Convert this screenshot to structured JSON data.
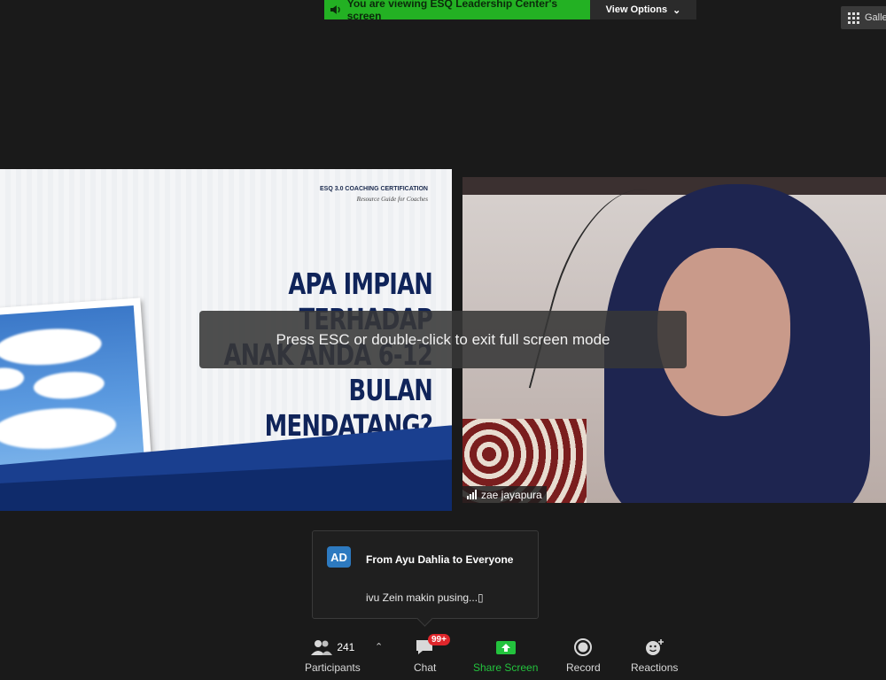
{
  "banner": {
    "text": "You are viewing ESQ Leadership Center's screen"
  },
  "view_options": {
    "label": "View Options"
  },
  "gallery": {
    "label": "Galle"
  },
  "slide": {
    "header_line1": "ESQ 3.0 COACHING CERTIFICATION",
    "header_line2": "Resource Guide for Coaches",
    "title_line1": "APA IMPIAN TERHADAP",
    "title_line2": "ANAK ANDA 6-12 BULAN",
    "title_line3": "MENDATANG?"
  },
  "video": {
    "participant_name": "zae jayapura"
  },
  "fullscreen_notice": {
    "text": "Press ESC or double-click to exit full screen mode"
  },
  "chat_popup": {
    "avatar_initials": "AD",
    "from": "From Ayu Dahlia to Everyone",
    "message": "ivu Zein makin pusing...▯"
  },
  "toolbar": {
    "participants_label": "Participants",
    "participants_count": "241",
    "chat_label": "Chat",
    "chat_badge": "99+",
    "share_label": "Share Screen",
    "record_label": "Record",
    "reactions_label": "Reactions"
  },
  "colors": {
    "banner_green": "#23b123",
    "share_green": "#23c23d",
    "badge_red": "#e0262b",
    "avatar_blue": "#2d7ac0"
  }
}
